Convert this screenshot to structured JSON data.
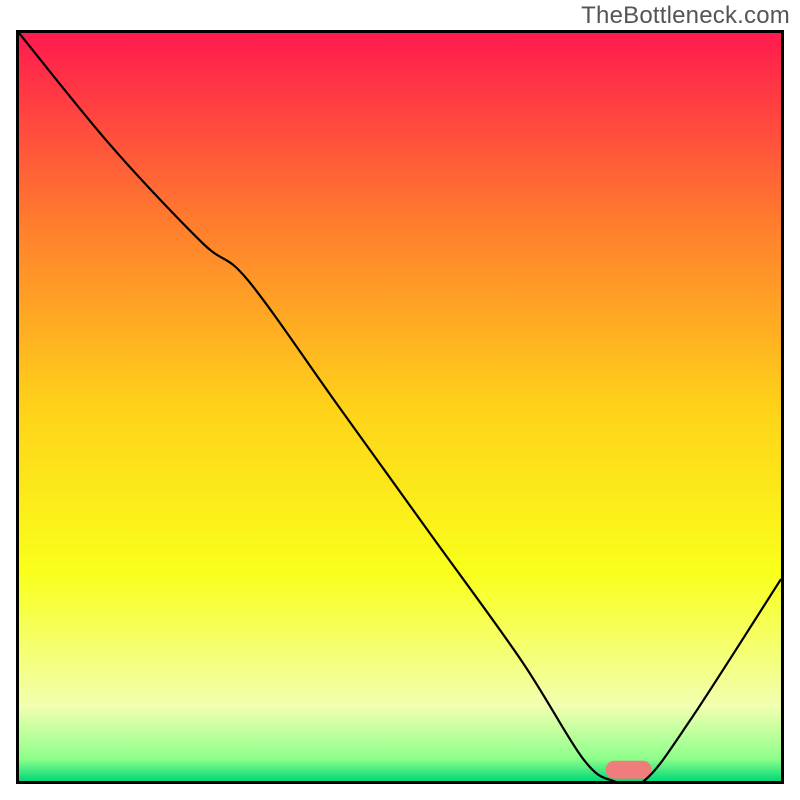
{
  "watermark": "TheBottleneck.com",
  "chart_data": {
    "type": "line",
    "title": "",
    "xlabel": "",
    "ylabel": "",
    "xlim": [
      0,
      100
    ],
    "ylim": [
      0,
      100
    ],
    "background_gradient": {
      "stops": [
        {
          "offset": 0.0,
          "color": "#ff1a4e"
        },
        {
          "offset": 0.25,
          "color": "#ff7b2e"
        },
        {
          "offset": 0.5,
          "color": "#ffd21a"
        },
        {
          "offset": 0.72,
          "color": "#f9ff1a"
        },
        {
          "offset": 0.9,
          "color": "#f1ffb0"
        },
        {
          "offset": 0.97,
          "color": "#8fff8c"
        },
        {
          "offset": 1.0,
          "color": "#00d977"
        }
      ]
    },
    "curve": {
      "comment": "y = bottleneck percentage (0 at bottom / best, 100 at top / worst); x = normalized configuration axis",
      "x": [
        0,
        12,
        24,
        30,
        42,
        54,
        66,
        74,
        78,
        82,
        88,
        100
      ],
      "y": [
        100,
        85,
        72,
        67,
        50,
        33,
        16,
        3,
        0,
        0,
        8,
        27
      ]
    },
    "optimal_marker": {
      "x_center": 80,
      "width": 6,
      "color": "#ee7d7b"
    }
  }
}
